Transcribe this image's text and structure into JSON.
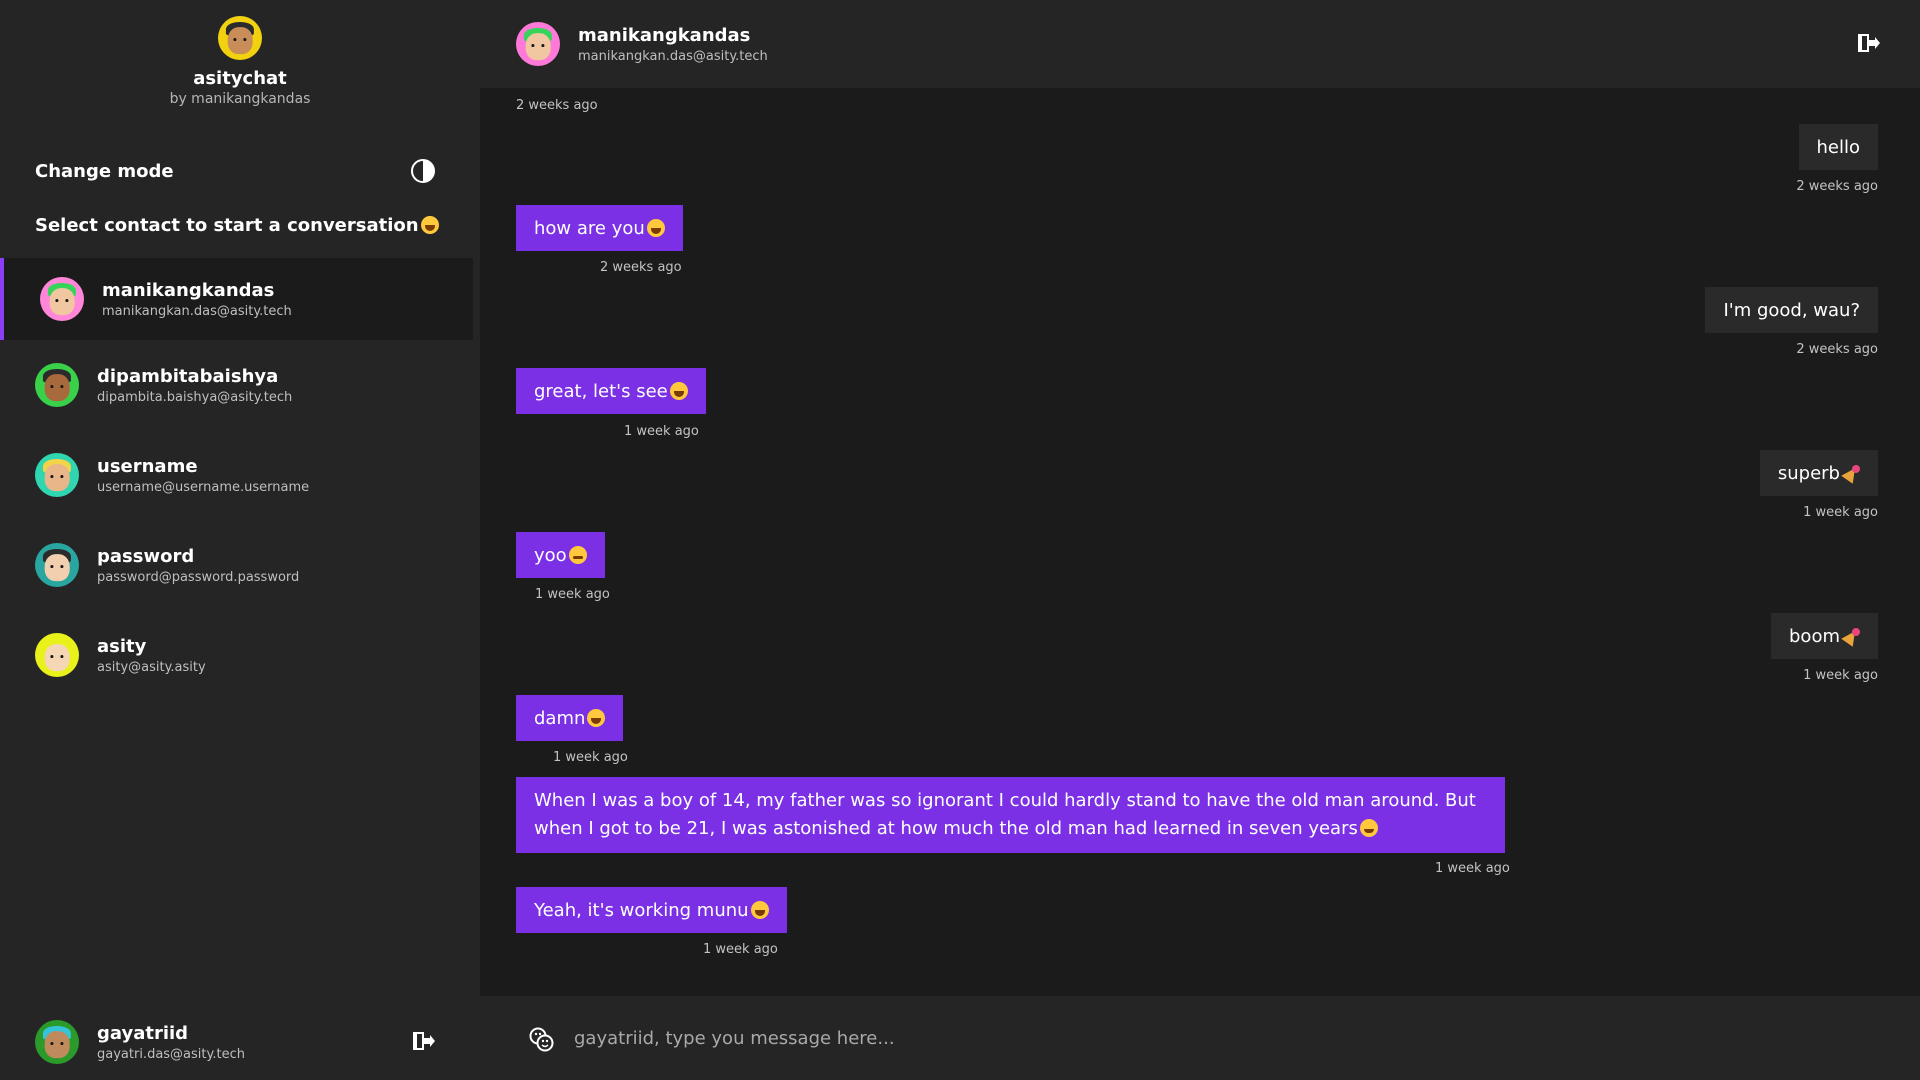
{
  "app": {
    "title": "asitychat",
    "byline": "by manikangkandas"
  },
  "sidebar": {
    "mode_label": "Change mode",
    "select_label": "Select contact to start a conversation",
    "contacts": [
      {
        "name": "manikangkandas",
        "email": "manikangkan.das@asity.tech",
        "active": true
      },
      {
        "name": "dipambitabaishya",
        "email": "dipambita.baishya@asity.tech",
        "active": false
      },
      {
        "name": "username",
        "email": "username@username.username",
        "active": false
      },
      {
        "name": "password",
        "email": "password@password.password",
        "active": false
      },
      {
        "name": "asity",
        "email": "asity@asity.asity",
        "active": false
      }
    ],
    "current_user": {
      "name": "gayatriid",
      "email": "gayatri.das@asity.tech"
    }
  },
  "chat": {
    "header": {
      "name": "manikangkandas",
      "email": "manikangkan.das@asity.tech"
    },
    "top_timestamp": "2 weeks ago",
    "messages": [
      {
        "direction": "out",
        "text": "hello",
        "time": "2 weeks ago"
      },
      {
        "direction": "in",
        "text": "how are you",
        "emoji": "grin",
        "time": "2 weeks ago"
      },
      {
        "direction": "out",
        "text": "I'm good, wau?",
        "time": "2 weeks ago"
      },
      {
        "direction": "in",
        "text": "great, let's see",
        "emoji": "grin",
        "time": "1 week ago"
      },
      {
        "direction": "out",
        "text": "superb",
        "emoji": "party",
        "time": "1 week ago"
      },
      {
        "direction": "in",
        "text": "yoo",
        "emoji": "thinking",
        "time": "1 week ago"
      },
      {
        "direction": "out",
        "text": "boom",
        "emoji": "party",
        "time": "1 week ago"
      },
      {
        "direction": "in",
        "text": "damn",
        "emoji": "grin",
        "time": "1 week ago"
      },
      {
        "direction": "in",
        "text": "When I was a boy of 14, my father was so ignorant I could hardly stand to have the old man around. But when I got to be 21, I was astonished at how much the old man had learned in seven years",
        "emoji": "blush",
        "time": "1 week ago"
      },
      {
        "direction": "in",
        "text": "Yeah, it's working munu",
        "emoji": "grin",
        "time": "1 week ago"
      }
    ],
    "composer_placeholder": "gayatriid, type you message here..."
  },
  "colors": {
    "accent": "#7b30e6",
    "sidebar_bg": "#252525",
    "chat_bg": "#1b1b1b",
    "outgoing_bubble": "#2a2a2a"
  },
  "icons": {
    "theme_toggle": "half-circle-icon",
    "logout": "logout-icon",
    "emoji_picker": "smiley-picker-icon"
  }
}
